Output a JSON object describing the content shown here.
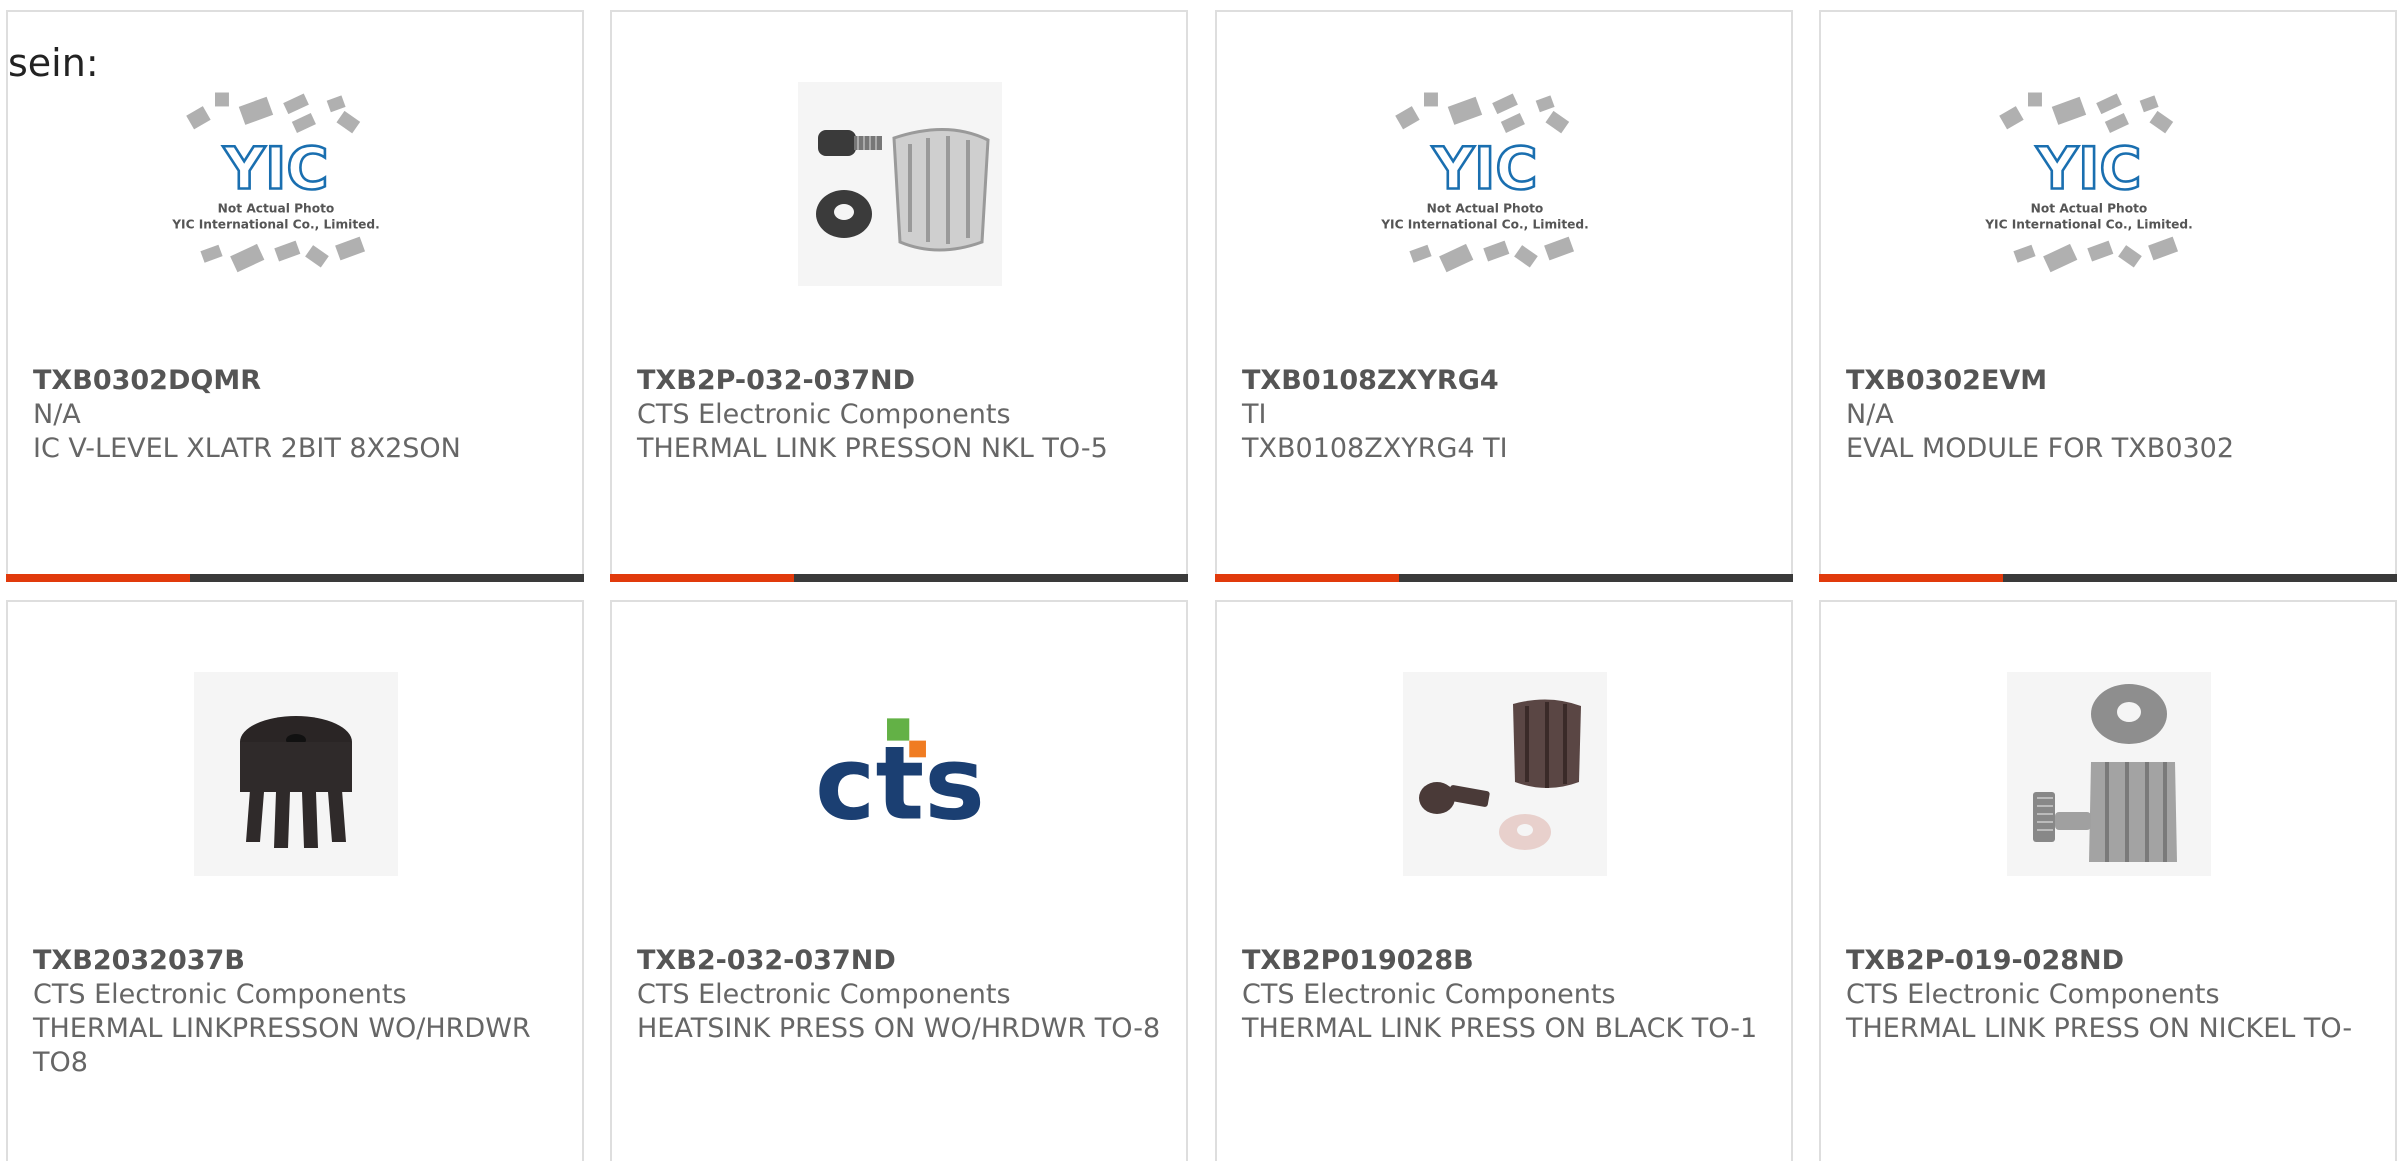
{
  "heading": "sein:",
  "products": [
    {
      "part_number": "TXB0302DQMR",
      "manufacturer": "N/A",
      "description": "IC V-LEVEL XLATR 2BIT 8X2SON",
      "image": "yic-placeholder",
      "placeholder_text": [
        "Not Actual Photo",
        "YIC International Co., Limited."
      ],
      "logo_text": "YIC"
    },
    {
      "part_number": "TXB2P-032-037ND",
      "manufacturer": "CTS Electronic Components",
      "description": "THERMAL LINK PRESSON NKL TO-5",
      "image": "nickel-press-link-with-screw-and-washer"
    },
    {
      "part_number": "TXB0108ZXYRG4",
      "manufacturer": "TI",
      "description": "TXB0108ZXYRG4 TI",
      "image": "yic-placeholder",
      "placeholder_text": [
        "Not Actual Photo",
        "YIC International Co., Limited."
      ],
      "logo_text": "YIC"
    },
    {
      "part_number": "TXB0302EVM",
      "manufacturer": "N/A",
      "description": "EVAL MODULE FOR TXB0302",
      "image": "yic-placeholder",
      "placeholder_text": [
        "Not Actual Photo",
        "YIC International Co., Limited."
      ],
      "logo_text": "YIC"
    },
    {
      "part_number": "TXB2032037B",
      "manufacturer": "CTS Electronic Components",
      "description": "THERMAL LINKPRESSON WO/HRDWR TO8",
      "image": "black-press-link"
    },
    {
      "part_number": "TXB2-032-037ND",
      "manufacturer": "CTS Electronic Components",
      "description": "HEATSINK PRESS ON WO/HRDWR TO-8",
      "image": "cts-logo",
      "logo_text": "cts"
    },
    {
      "part_number": "TXB2P019028B",
      "manufacturer": "CTS Electronic Components",
      "description": "THERMAL LINK PRESS ON BLACK TO-1",
      "image": "black-press-link-with-screw-and-washer"
    },
    {
      "part_number": "TXB2P-019-028ND",
      "manufacturer": "CTS Electronic Components",
      "description": "THERMAL LINK PRESS ON NICKEL TO-",
      "image": "nickel-press-link-with-screw-and-washer"
    }
  ],
  "colors": {
    "accent": "#e13a0c",
    "bar": "#3a3a3a",
    "text": "#666666",
    "yic_blue": "#1a6fb0",
    "cts_blue": "#1b3f72",
    "cts_orange": "#f07c22",
    "cts_green": "#63b146"
  }
}
